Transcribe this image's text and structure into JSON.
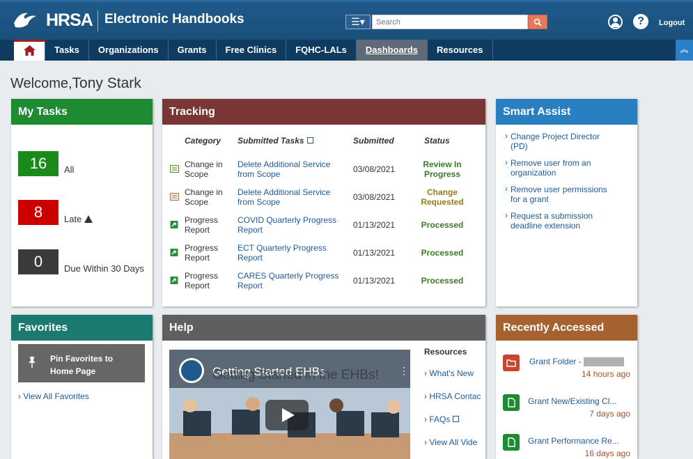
{
  "header": {
    "logo_text": "HRSA",
    "app_title": "Electronic Handbooks",
    "search_placeholder": "Search",
    "logout_label": "Logout"
  },
  "nav": {
    "items": [
      "Tasks",
      "Organizations",
      "Grants",
      "Free Clinics",
      "FQHC-LALs",
      "Dashboards",
      "Resources"
    ],
    "active": "Dashboards"
  },
  "welcome": {
    "prefix": "Welcome,",
    "name": "Tony Stark"
  },
  "my_tasks": {
    "title": "My Tasks",
    "items": [
      {
        "count": "16",
        "label": "All",
        "color": "#1a8a1a"
      },
      {
        "count": "8",
        "label": "Late",
        "color": "#cc0000"
      },
      {
        "count": "0",
        "label": "Due Within 30 Days",
        "color": "#3a3a3a"
      }
    ]
  },
  "tracking": {
    "title": "Tracking",
    "headers": {
      "category": "Category",
      "submitted_tasks": "Submitted Tasks",
      "submitted": "Submitted",
      "status": "Status"
    },
    "rows": [
      {
        "category": [
          "Change in",
          "Scope"
        ],
        "task": [
          "Delete Additional Service",
          "from Scope"
        ],
        "date": "03/08/2021",
        "status": [
          "Review In",
          "Progress"
        ],
        "status_color": "#3a7a2a"
      },
      {
        "category": [
          "Change in",
          "Scope"
        ],
        "task": [
          "Delete Additional Service",
          "from Scope"
        ],
        "date": "03/08/2021",
        "status": [
          "Change",
          "Requested"
        ],
        "status_color": "#9a7a1a"
      },
      {
        "category": [
          "Progress",
          "Report"
        ],
        "task": [
          "COVID Quarterly Progress",
          "Report"
        ],
        "date": "01/13/2021",
        "status": [
          "Processed"
        ],
        "status_color": "#3a7a2a"
      },
      {
        "category": [
          "Progress",
          "Report"
        ],
        "task": [
          "ECT Quarterly Progress",
          "Report"
        ],
        "date": "01/13/2021",
        "status": [
          "Processed"
        ],
        "status_color": "#3a7a2a"
      },
      {
        "category": [
          "Progress",
          "Report"
        ],
        "task": [
          "CARES Quarterly Progress",
          "Report"
        ],
        "date": "01/13/2021",
        "status": [
          "Processed"
        ],
        "status_color": "#3a7a2a"
      }
    ]
  },
  "smart_assist": {
    "title": "Smart Assist",
    "items": [
      [
        "Change Project Director",
        "(PD)"
      ],
      [
        "Remove user from an",
        "organization"
      ],
      [
        "Remove user permissions",
        "for a grant"
      ],
      [
        "Request a submission",
        "deadline extension"
      ]
    ]
  },
  "favorites": {
    "title": "Favorites",
    "pin_label": [
      "Pin Favorites to",
      "Home Page"
    ],
    "view_all": "View All Favorites"
  },
  "help": {
    "title": "Help",
    "video_title": "Getting Started EHBs",
    "video_caption": "Getting Started in the EHBs!",
    "resources_title": "Resources",
    "resources": [
      "What's New",
      "HRSA Contac",
      "FAQs",
      "View All Vide"
    ]
  },
  "recently_accessed": {
    "title": "Recently Accessed",
    "items": [
      {
        "title": "Grant Folder -",
        "time": "14 hours ago",
        "icon": "folder-icon"
      },
      {
        "title": "Grant New/Existing Cl...",
        "time": "7 days ago",
        "icon": "document-icon"
      },
      {
        "title": "Grant Performance Re...",
        "time": "16 days ago",
        "icon": "document-icon"
      }
    ]
  }
}
